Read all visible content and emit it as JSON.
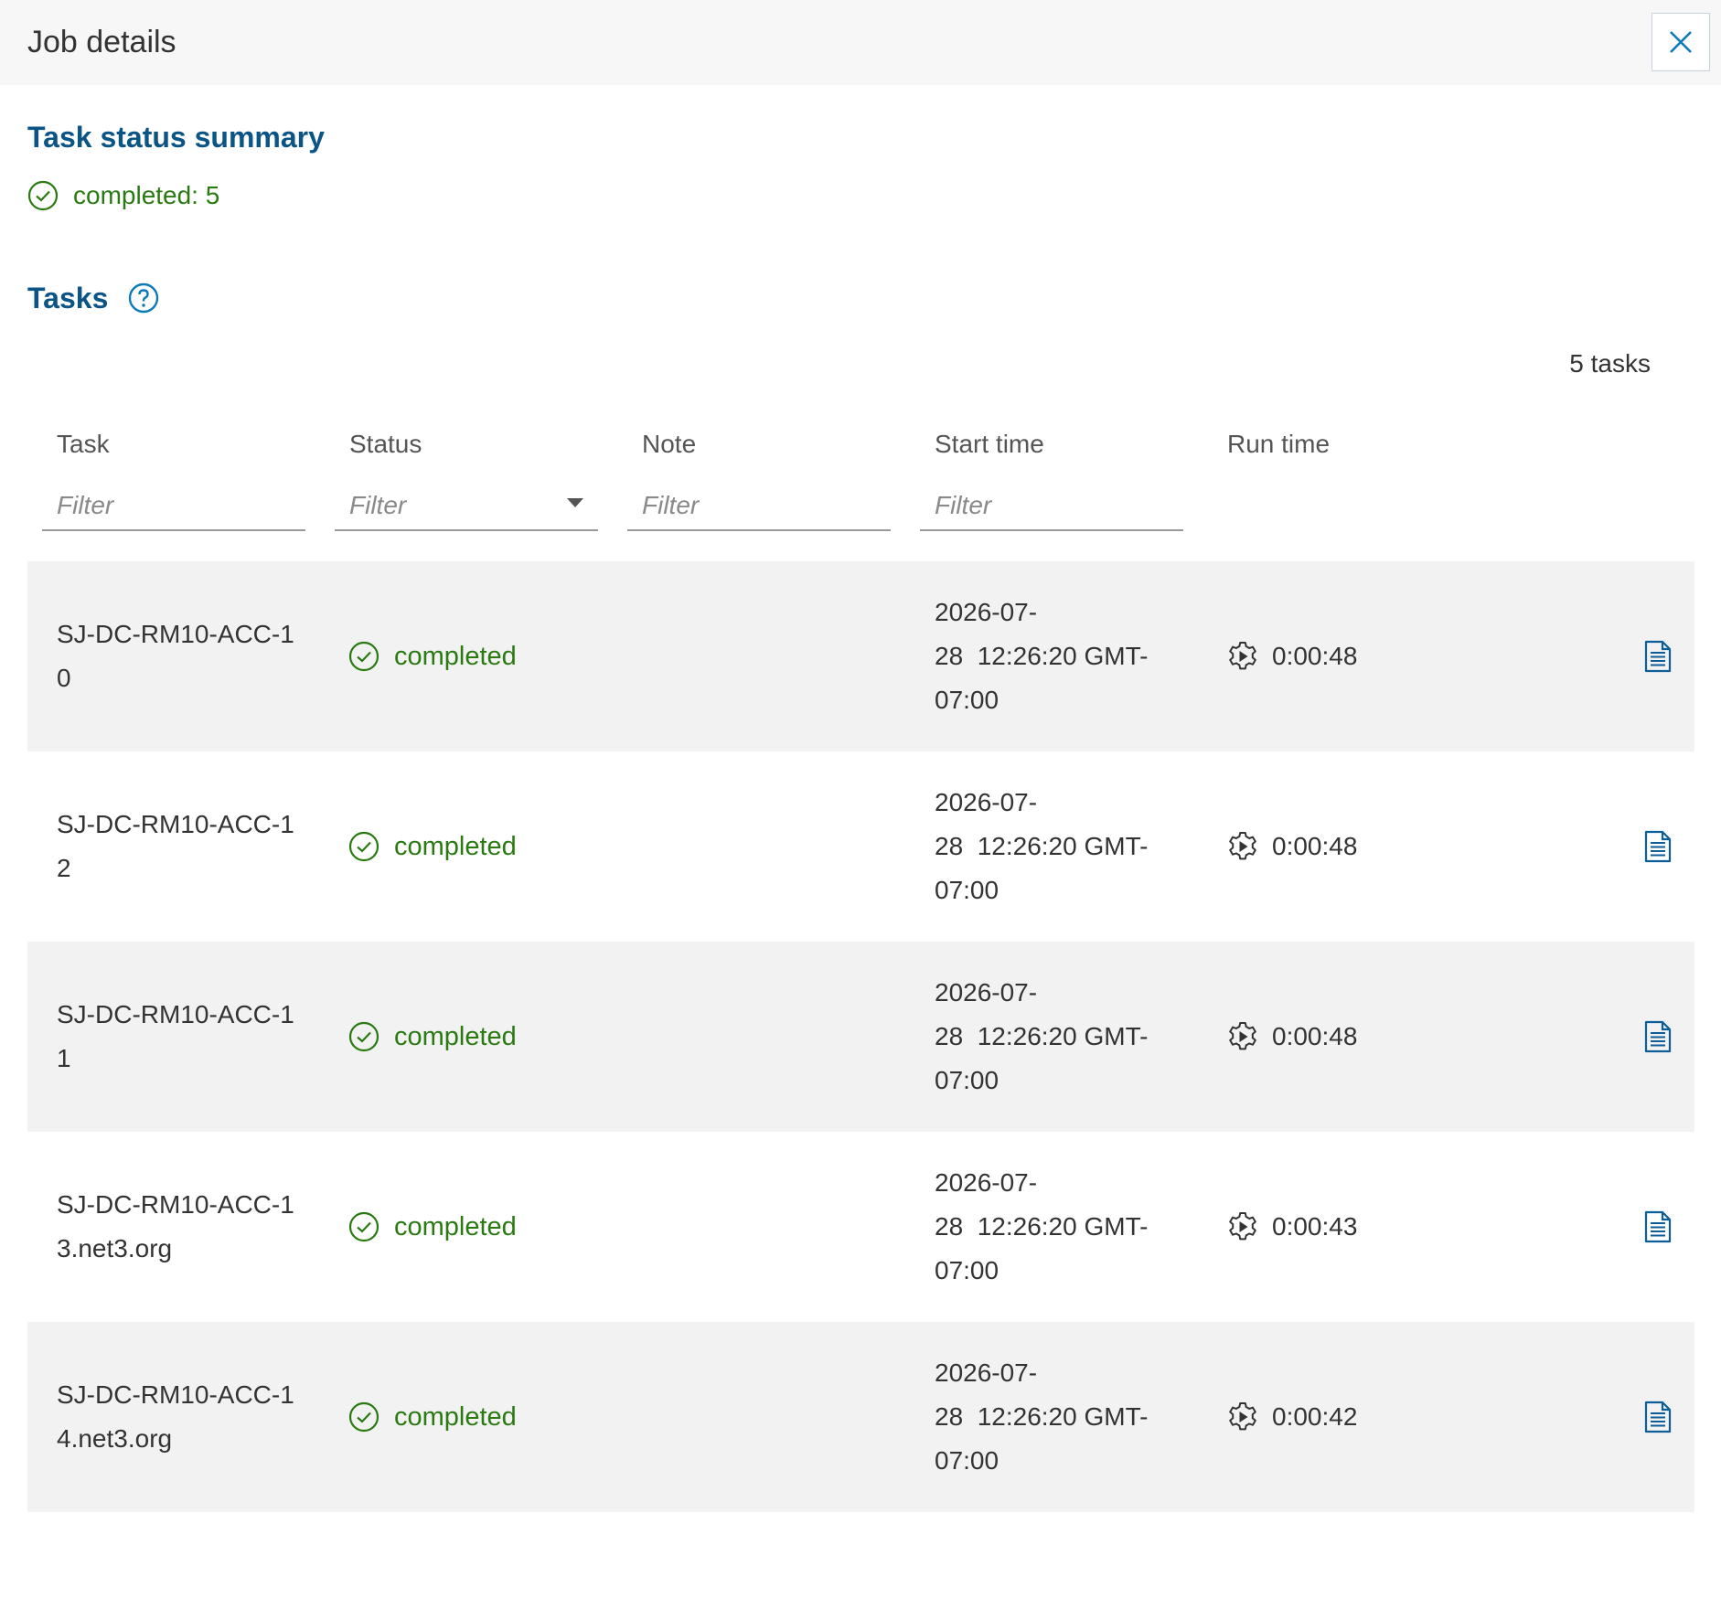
{
  "header": {
    "title": "Job details",
    "close_icon": "close-icon"
  },
  "summary": {
    "title": "Task status summary",
    "completed_text": "completed: 5",
    "icon": "check-circle-icon",
    "status_color": "#2a7a12"
  },
  "tasks_section": {
    "title": "Tasks",
    "help_icon": "help-icon",
    "count_text": "5 tasks"
  },
  "table": {
    "columns": [
      {
        "label": "Task",
        "filter_placeholder": "Filter"
      },
      {
        "label": "Status",
        "filter_placeholder": "Filter"
      },
      {
        "label": "Note",
        "filter_placeholder": "Filter"
      },
      {
        "label": "Start time",
        "filter_placeholder": "Filter"
      },
      {
        "label": "Run time"
      }
    ],
    "rows": [
      {
        "task": "SJ-DC-RM10-ACC-10",
        "status": "completed",
        "note": "",
        "start_line1": "2026-07-",
        "start_line2": "28  12:26:20 GMT-",
        "start_line3": "07:00",
        "run_time": "0:00:48"
      },
      {
        "task": "SJ-DC-RM10-ACC-12",
        "status": "completed",
        "note": "",
        "start_line1": "2026-07-",
        "start_line2": "28  12:26:20 GMT-",
        "start_line3": "07:00",
        "run_time": "0:00:48"
      },
      {
        "task": "SJ-DC-RM10-ACC-11",
        "status": "completed",
        "note": "",
        "start_line1": "2026-07-",
        "start_line2": "28  12:26:20 GMT-",
        "start_line3": "07:00",
        "run_time": "0:00:48"
      },
      {
        "task": "SJ-DC-RM10-ACC-13.net3.org",
        "status": "completed",
        "note": "",
        "start_line1": "2026-07-",
        "start_line2": "28  12:26:20 GMT-",
        "start_line3": "07:00",
        "run_time": "0:00:43"
      },
      {
        "task": "SJ-DC-RM10-ACC-14.net3.org",
        "status": "completed",
        "note": "",
        "start_line1": "2026-07-",
        "start_line2": "28  12:26:20 GMT-",
        "start_line3": "07:00",
        "run_time": "0:00:42"
      }
    ]
  },
  "colors": {
    "accent": "#0b5486",
    "success": "#2a7a12",
    "row_shade": "#f2f2f2",
    "header_bg": "#f7f7f7"
  }
}
